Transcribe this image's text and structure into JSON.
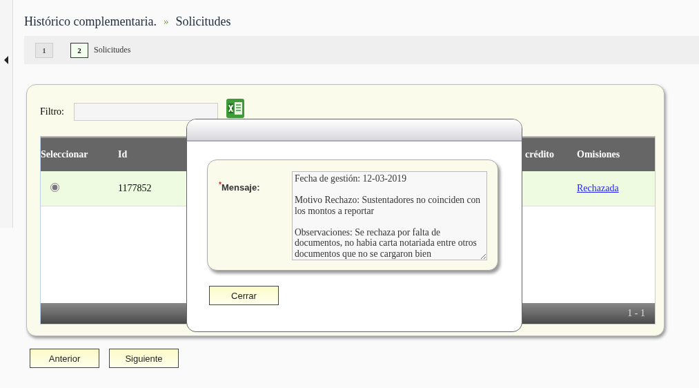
{
  "breadcrumb": {
    "items": [
      "Histórico complementaria.",
      "Solicitudes"
    ],
    "separator": "»"
  },
  "steps": [
    {
      "number": "1",
      "selected": false
    },
    {
      "number": "2",
      "label": "Solicitudes",
      "selected": true
    }
  ],
  "filter": {
    "label": "Filtro:"
  },
  "table": {
    "columns": [
      "Seleccionar",
      "Id",
      "crédito",
      "Omisiones"
    ],
    "rows": [
      {
        "selected": true,
        "id": "1177852",
        "omisiones": "Rechazada"
      }
    ],
    "pager": "1 - 1"
  },
  "buttons": [
    "Anterior",
    "Siguiente"
  ],
  "dialog": {
    "required_mark": "*",
    "label": "Mensaje:",
    "value": "Fecha de gestión: 12-03-2019\n\nMotivo Rechazo: Sustentadores no coinciden con los montos a reportar\n\nObservaciones: Se rechaza por falta de documentos, no habia carta notariada entre otros documentos que no se cargaron bien",
    "button": "Cerrar"
  }
}
